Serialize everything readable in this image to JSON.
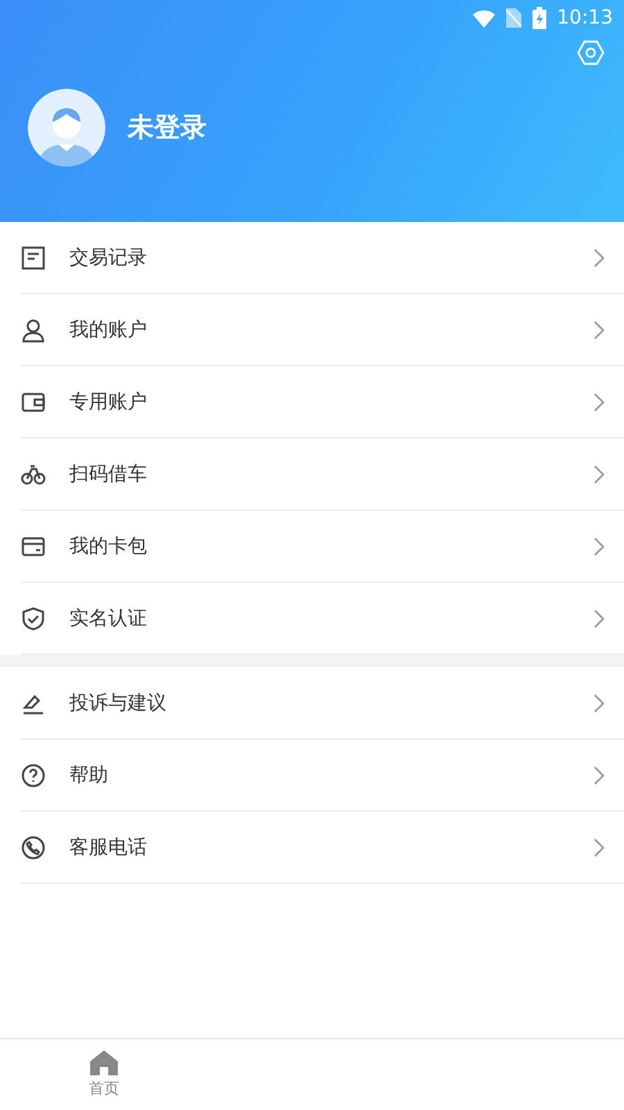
{
  "status_bar": {
    "time": "10:13"
  },
  "profile": {
    "name": "未登录"
  },
  "menu_groups": [
    {
      "items": [
        {
          "label": "交易记录"
        },
        {
          "label": "我的账户"
        },
        {
          "label": "专用账户"
        },
        {
          "label": "扫码借车"
        },
        {
          "label": "我的卡包"
        },
        {
          "label": "实名认证"
        }
      ]
    },
    {
      "items": [
        {
          "label": "投诉与建议"
        },
        {
          "label": "帮助"
        },
        {
          "label": "客服电话"
        }
      ]
    }
  ],
  "tab_bar": [
    {
      "label": "首页",
      "selected": false
    }
  ]
}
